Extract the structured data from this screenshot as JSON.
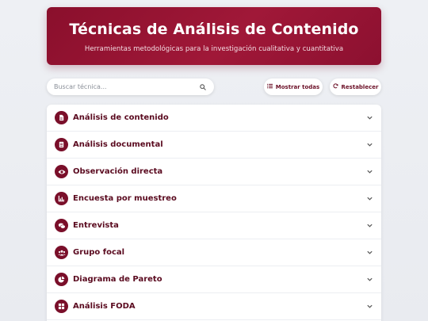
{
  "header": {
    "title": "Técnicas de Análisis de Contenido",
    "subtitle": "Herramientas metodológicas para la investigación cualitativa y cuantitativa"
  },
  "search": {
    "placeholder": "Buscar técnica..."
  },
  "toolbar": {
    "show_all_label": "Mostrar todas",
    "reset_label": "Restablecer"
  },
  "colors": {
    "accent": "#8a0f2c",
    "text": "#5a0a1f"
  },
  "techniques": [
    {
      "label": "Análisis de contenido",
      "icon": "document-icon"
    },
    {
      "label": "Análisis documental",
      "icon": "file-icon"
    },
    {
      "label": "Observación directa",
      "icon": "eye-icon"
    },
    {
      "label": "Encuesta por muestreo",
      "icon": "chart-icon"
    },
    {
      "label": "Entrevista",
      "icon": "chat-icon"
    },
    {
      "label": "Grupo focal",
      "icon": "users-icon"
    },
    {
      "label": "Diagrama de Pareto",
      "icon": "pie-icon"
    },
    {
      "label": "Análisis FODA",
      "icon": "grid-icon"
    }
  ]
}
